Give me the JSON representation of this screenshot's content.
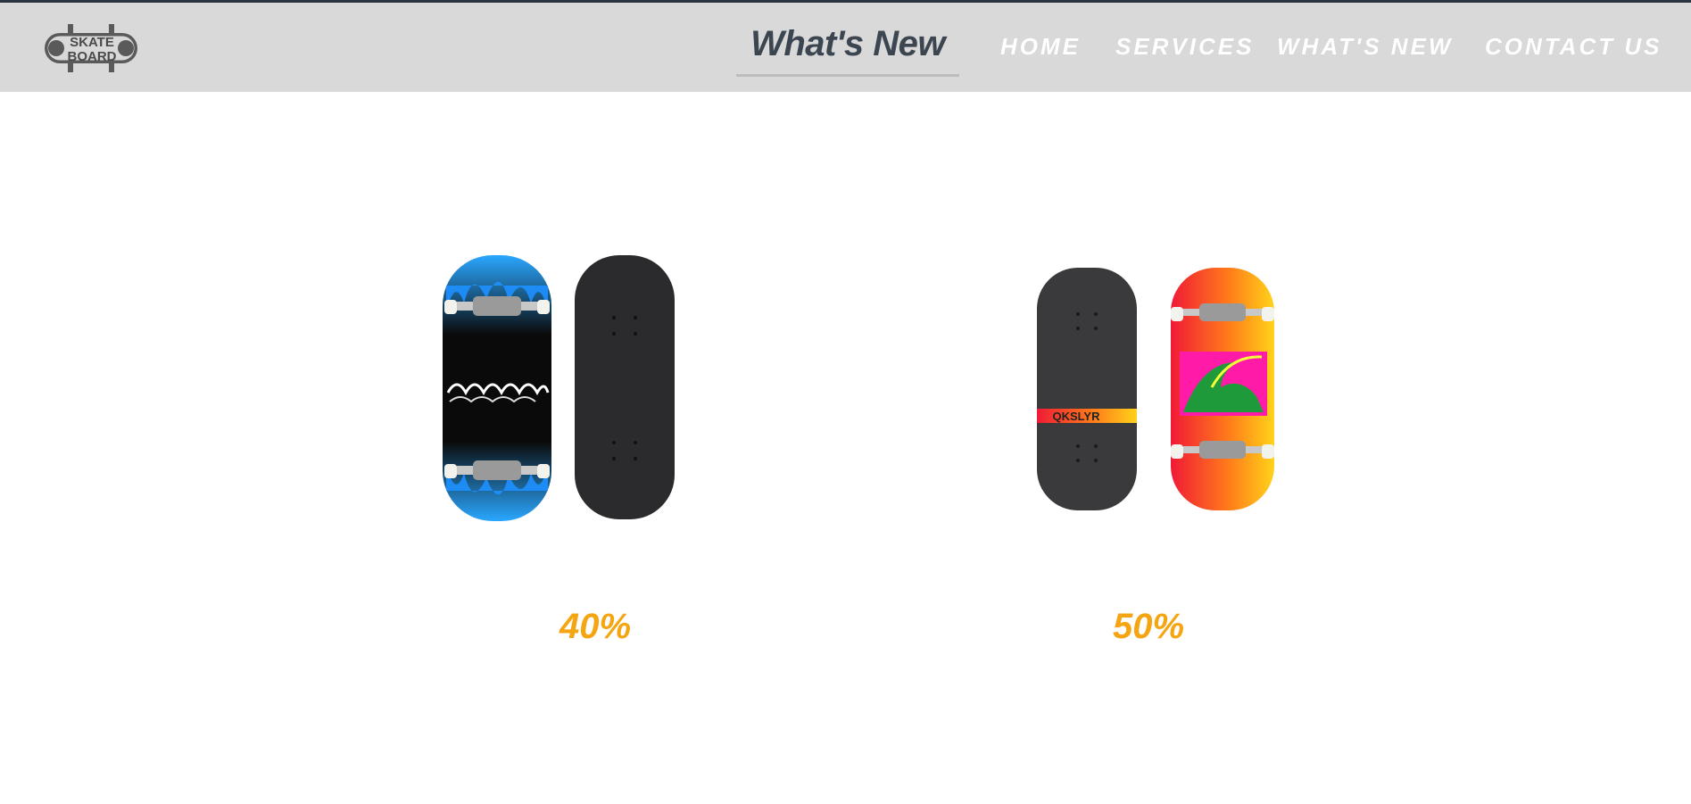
{
  "logo": {
    "line1": "SKATE",
    "line2": "BOARD"
  },
  "header": {
    "title": "What's New"
  },
  "nav": {
    "items": [
      {
        "label": "HOME"
      },
      {
        "label": "SERVICES"
      },
      {
        "label": "WHAT'S NEW"
      },
      {
        "label": "CONTACT US"
      }
    ]
  },
  "products": [
    {
      "discount": "40%",
      "image": "blue-flame-skateboard-pair"
    },
    {
      "discount": "50%",
      "image": "red-yellow-wave-skateboard-pair",
      "grip_label": "QKSLYR"
    }
  ],
  "colors": {
    "header_bg": "#d9d9d9",
    "discount": "#f5a512",
    "title": "#3c4650",
    "nav_text": "#ffffff"
  }
}
